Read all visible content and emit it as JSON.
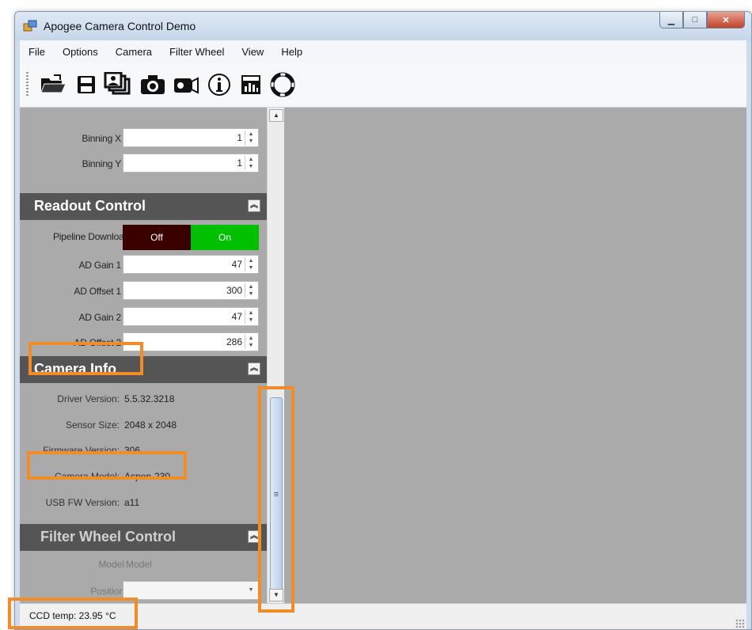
{
  "window": {
    "title": "Apogee Camera Control Demo"
  },
  "menubar": {
    "items": [
      "File",
      "Options",
      "Camera",
      "Filter Wheel",
      "View",
      "Help"
    ]
  },
  "toolbar": {
    "buttons": [
      "open-folder-icon",
      "save-icon",
      "multi-image-icon",
      "camera-icon",
      "video-camera-icon",
      "info-icon",
      "histogram-icon",
      "lifebuoy-icon"
    ]
  },
  "binning": {
    "x": {
      "label": "Binning X",
      "value": "1"
    },
    "y": {
      "label": "Binning Y",
      "value": "1"
    }
  },
  "readout": {
    "title": "Readout Control",
    "pipeline_label": "Pipeline Download",
    "off_label": "Off",
    "on_label": "On",
    "selected": "On",
    "ad_gain_1": {
      "label": "AD Gain 1",
      "value": "47"
    },
    "ad_offset_1": {
      "label": "AD Offset 1",
      "value": "300"
    },
    "ad_gain_2": {
      "label": "AD Gain 2",
      "value": "47"
    },
    "ad_offset_2": {
      "label": "AD Offset 2",
      "value": "286"
    }
  },
  "camera_info": {
    "title": "Camera Info",
    "driver": {
      "label": "Driver Version:",
      "value": "5.5.32.3218"
    },
    "sensor": {
      "label": "Sensor Size:",
      "value": "2048 x 2048"
    },
    "firmware": {
      "label": "Firmware Version:",
      "value": "306"
    },
    "model": {
      "label": "Camera Model:",
      "value": "Aspen-230"
    },
    "usb_fw": {
      "label": "USB FW Version:",
      "value": "a11"
    }
  },
  "filter_wheel": {
    "title": "Filter Wheel Control",
    "model_label": "Model",
    "model_value": "Model",
    "position_label": "Position",
    "position_value": ""
  },
  "status": {
    "text": "CCD temp: 23.95 °C"
  },
  "colors": {
    "highlight": "#f28c28",
    "off_bg": "#3a0000",
    "on_bg": "#00c000",
    "panel": "#aaaaaa",
    "header": "#555555"
  }
}
